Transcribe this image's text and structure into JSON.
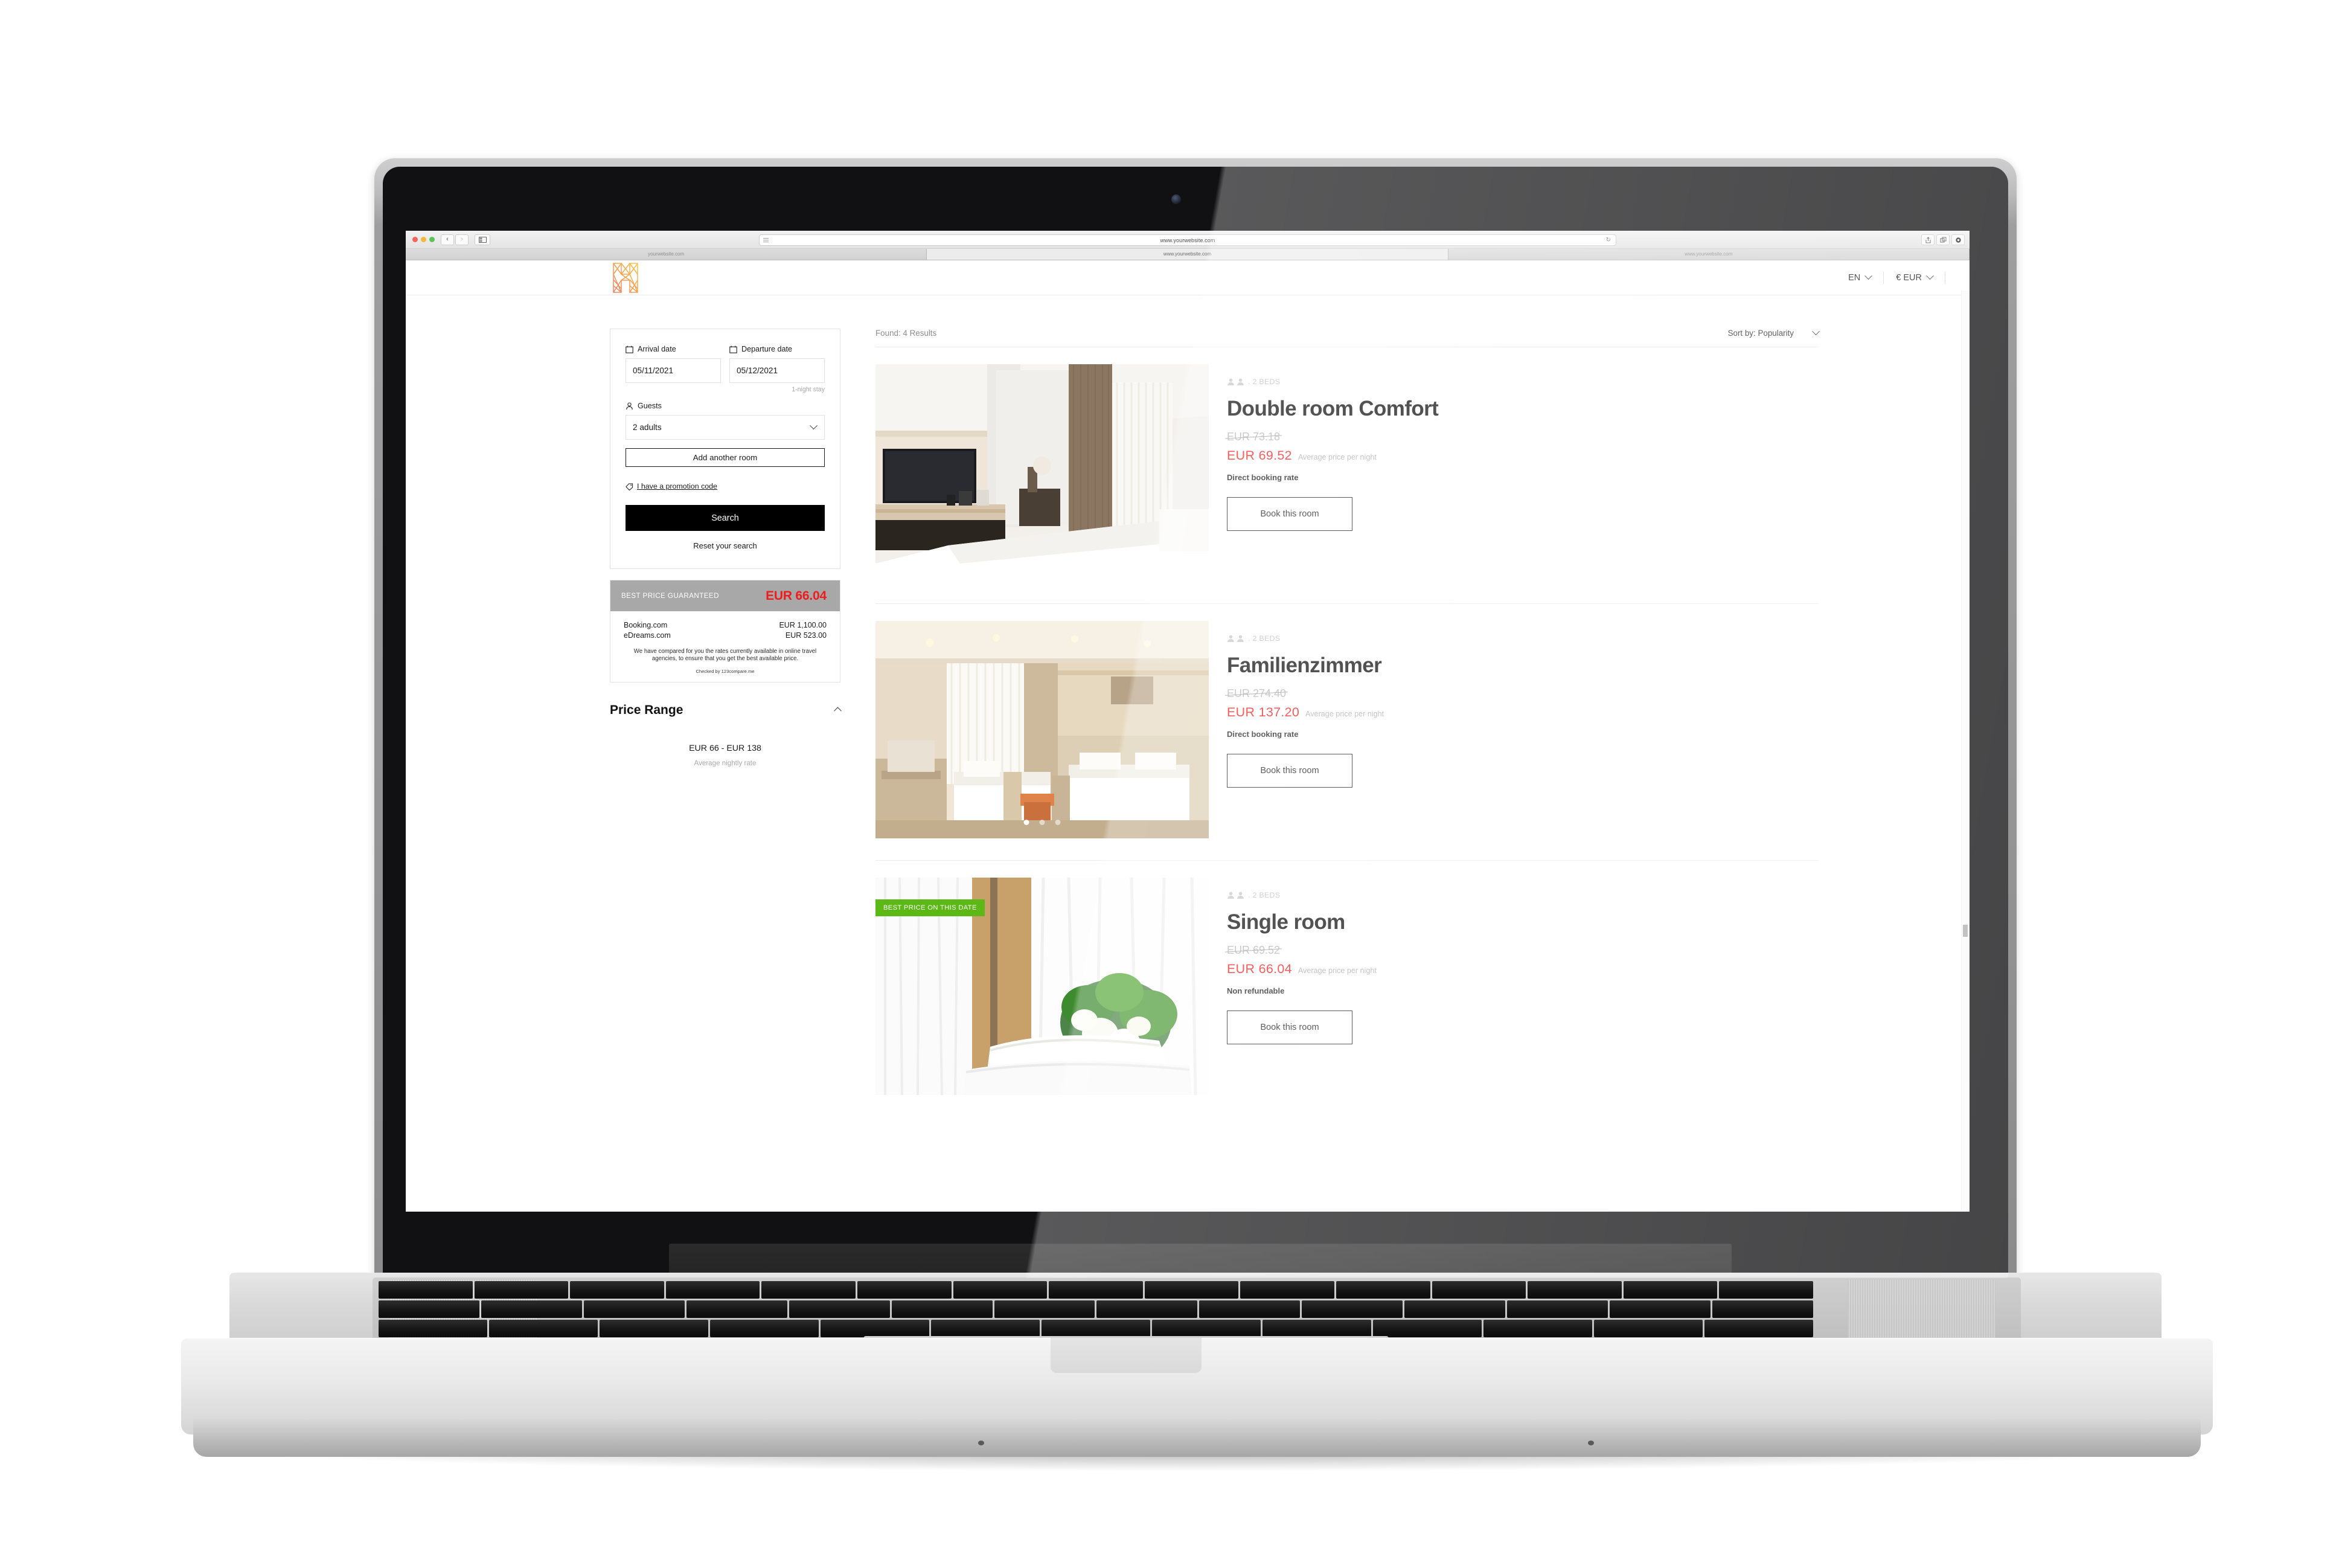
{
  "browser": {
    "url": "www.yourwebsite.com",
    "traffic_lights": [
      "close-red",
      "minimize-yellow",
      "maximize-green"
    ],
    "back_label": "‹",
    "forward_label": "›",
    "tabs": [
      {
        "label": "yourwebsite.com",
        "active": false
      },
      {
        "label": "www.yourwebsite.com",
        "active": true
      },
      {
        "label": "www.yourwebsite.com",
        "active": false
      }
    ],
    "toolbar_icons": [
      "share-icon",
      "tabs-icon",
      "settings-icon"
    ]
  },
  "header": {
    "logo_name": "hotel-h-logo",
    "language": {
      "label": "EN",
      "icon": "chevron-down-icon"
    },
    "currency": {
      "label": "€ EUR",
      "icon": "chevron-down-icon"
    }
  },
  "search": {
    "arrival": {
      "label": "Arrival date",
      "value": "05/11/2021",
      "icon": "calendar-icon"
    },
    "departure": {
      "label": "Departure date",
      "value": "05/12/2021",
      "icon": "calendar-icon"
    },
    "stay_note": "1-night stay",
    "guests": {
      "label": "Guests",
      "value": "2 adults",
      "icon": "person-icon"
    },
    "add_room_label": "Add another room",
    "promo_label": "I have a promotion code",
    "promo_icon": "tag-icon",
    "search_label": "Search",
    "reset_label": "Reset your search"
  },
  "best_price": {
    "title": "BEST PRICE GUARANTEED",
    "amount": "EUR 66.04",
    "amount_color": "#ee1c1c",
    "header_bg": "#a8a8a8",
    "comparisons": [
      {
        "site": "Booking.com",
        "price": "EUR 1,100.00"
      },
      {
        "site": "eDreams.com",
        "price": "EUR 523.00"
      }
    ],
    "description": "We have compared for you the rates currently available in online travel agencies, to ensure that you get the best available price.",
    "checked_by": "Checked by 123compare.me"
  },
  "price_range": {
    "title": "Price Range",
    "collapse_icon": "chevron-up-icon",
    "range": "EUR 66 - EUR 138",
    "subtitle": "Average nightly rate"
  },
  "results": {
    "found_label": "Found: 4 Results",
    "sort_label": "Sort by: Popularity",
    "sort_icon": "chevron-down-icon",
    "rooms": [
      {
        "beds": ". 2 BEDS",
        "name": "Double room Comfort",
        "old_price": "EUR  73.18",
        "new_price": "EUR  69.52",
        "price_note": "Average price per night",
        "rate": "Direct booking rate",
        "book_label": "Book this room",
        "badge": null,
        "dots": 3,
        "active_dot": 0,
        "image_name": "double-room-comfort-photo"
      },
      {
        "beds": ". 2 BEDS",
        "name": "Familienzimmer",
        "old_price": "EUR  274.40",
        "new_price": "EUR  137.20",
        "price_note": "Average price per night",
        "rate": "Direct booking rate",
        "book_label": "Book this room",
        "badge": null,
        "dots": 3,
        "active_dot": 0,
        "image_name": "familienzimmer-photo"
      },
      {
        "beds": ". 2 BEDS",
        "name": "Single room",
        "old_price": "EUR  69.52",
        "new_price": "EUR  66.04",
        "price_note": "Average price per night",
        "rate": "Non refundable",
        "book_label": "Book this room",
        "badge": "BEST PRICE ON THIS DATE",
        "badge_color": "#5cb915",
        "dots": 0,
        "active_dot": 0,
        "image_name": "single-room-photo"
      }
    ]
  }
}
